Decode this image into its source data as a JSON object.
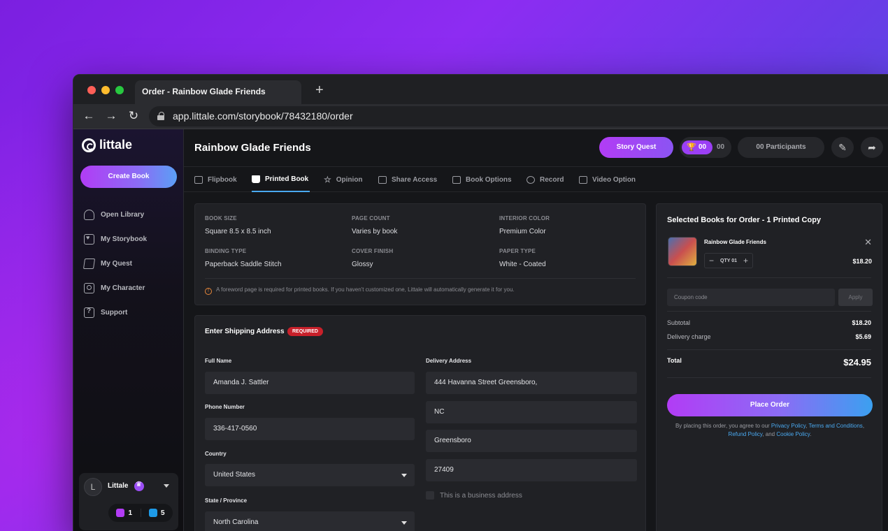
{
  "browser": {
    "tab_title": "Order - Rainbow Glade Friends",
    "url": "app.littale.com/storybook/78432180/order"
  },
  "sidebar": {
    "logo": "littale",
    "create_label": "Create Book",
    "items": [
      {
        "label": "Open Library",
        "icon": "library-icon"
      },
      {
        "label": "My Storybook",
        "icon": "storybook-icon"
      },
      {
        "label": "My Quest",
        "icon": "quest-icon"
      },
      {
        "label": "My Character",
        "icon": "character-icon"
      },
      {
        "label": "Support",
        "icon": "support-icon"
      }
    ],
    "user": {
      "initial": "L",
      "name": "Littale",
      "books": "1",
      "messages": "5"
    }
  },
  "header": {
    "title": "Rainbow Glade Friends",
    "quest_label": "Story Quest",
    "trophy_score": "00",
    "score": "00",
    "participants": "00 Participants"
  },
  "tabs": [
    {
      "label": "Flipbook"
    },
    {
      "label": "Printed Book"
    },
    {
      "label": "Opinion"
    },
    {
      "label": "Share Access"
    },
    {
      "label": "Book Options"
    },
    {
      "label": "Record"
    },
    {
      "label": "Video Option"
    }
  ],
  "specs": {
    "book_size": {
      "label": "BOOK SIZE",
      "value": "Square 8.5 x 8.5 inch"
    },
    "page_count": {
      "label": "PAGE COUNT",
      "value": "Varies by book"
    },
    "interior_color": {
      "label": "INTERIOR COLOR",
      "value": "Premium Color"
    },
    "binding_type": {
      "label": "BINDING TYPE",
      "value": "Paperback Saddle Stitch"
    },
    "cover_finish": {
      "label": "COVER FINISH",
      "value": "Glossy"
    },
    "paper_type": {
      "label": "PAPER TYPE",
      "value": "White - Coated"
    },
    "note": "A foreword page is required for printed books. If you haven't customized one, Littale will automatically generate it for you."
  },
  "shipping": {
    "title": "Enter Shipping Address",
    "required_badge": "REQUIRED",
    "full_name_label": "Full Name",
    "full_name": "Amanda J. Sattler",
    "phone_label": "Phone Number",
    "phone": "336-417-0560",
    "country_label": "Country",
    "country": "United States",
    "state_label": "State / Province",
    "state": "North Carolina",
    "delivery_label": "Delivery Address",
    "address_line": "444 Havanna Street Greensboro,",
    "region": "NC",
    "city": "Greensboro",
    "zip": "27409",
    "business_checkbox": "This is a business address"
  },
  "order": {
    "title": "Selected Books for Order - 1 Printed Copy",
    "item_title": "Rainbow Glade Friends",
    "qty_label": "QTY 01",
    "item_price": "$18.20",
    "coupon_placeholder": "Coupon code",
    "apply_label": "Apply",
    "subtotal_label": "Subtotal",
    "subtotal": "$18.20",
    "delivery_label": "Delivery charge",
    "delivery": "$5.69",
    "total_label": "Total",
    "total": "$24.95",
    "place_label": "Place Order",
    "terms_prefix": "By placing this order, you agree to our",
    "privacy": "Privacy Policy",
    "terms_link": "Terms and Conditions",
    "refund": "Refund Policy",
    "cookie": "Cookie Policy"
  }
}
